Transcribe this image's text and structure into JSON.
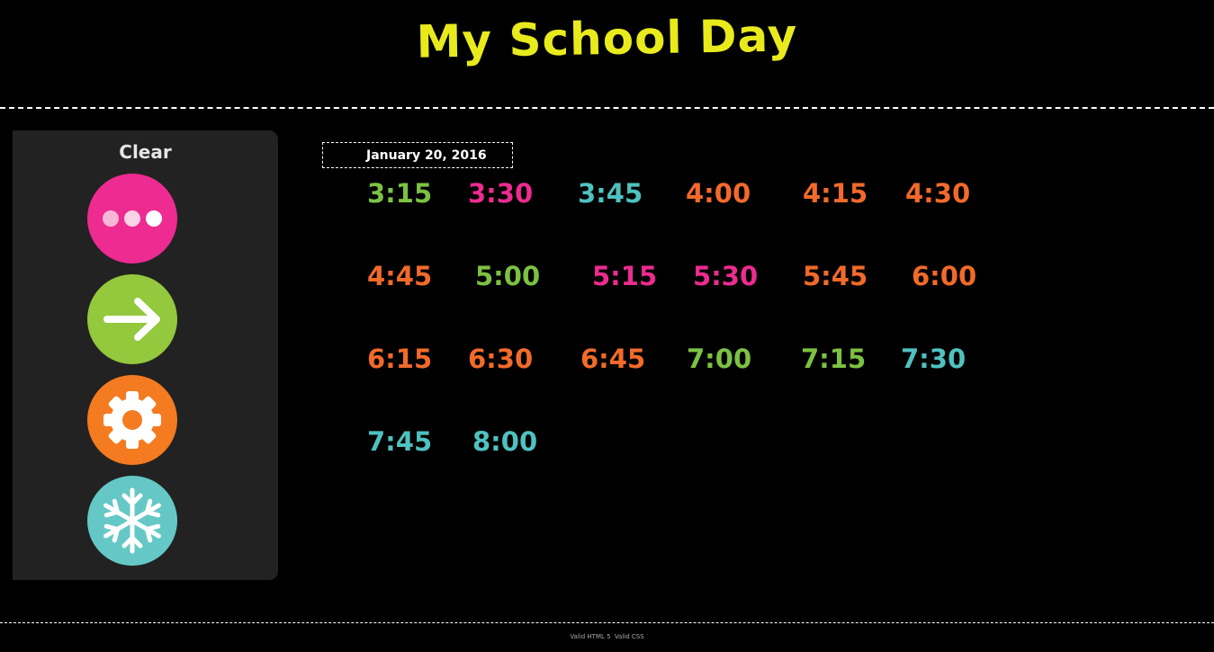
{
  "header": {
    "title": "My School Day"
  },
  "sidebar": {
    "clear_label": "Clear",
    "buttons": [
      {
        "name": "more-button",
        "icon": "ellipsis-icon",
        "color": "#ed2b91"
      },
      {
        "name": "next-button",
        "icon": "arrow-right-icon",
        "color": "#94c83d"
      },
      {
        "name": "settings-button",
        "icon": "gear-icon",
        "color": "#f47b20"
      },
      {
        "name": "snow-button",
        "icon": "snowflake-icon",
        "color": "#65c8c6"
      }
    ]
  },
  "date": {
    "value": "January 20, 2016"
  },
  "times": [
    {
      "label": "3:15",
      "color": "#7cc242"
    },
    {
      "label": "3:30",
      "color": "#ed2b91"
    },
    {
      "label": "3:45",
      "color": "#4fc1c0"
    },
    {
      "label": "4:00",
      "color": "#f26a2a"
    },
    {
      "label": "4:15",
      "color": "#f26a2a"
    },
    {
      "label": "4:30",
      "color": "#f26a2a"
    },
    {
      "label": "4:45",
      "color": "#f26a2a"
    },
    {
      "label": "5:00",
      "color": "#7cc242"
    },
    {
      "label": "5:15",
      "color": "#ed2b91"
    },
    {
      "label": "5:30",
      "color": "#ed2b91"
    },
    {
      "label": "5:45",
      "color": "#f26a2a"
    },
    {
      "label": "6:00",
      "color": "#f26a2a"
    },
    {
      "label": "6:15",
      "color": "#f26a2a"
    },
    {
      "label": "6:30",
      "color": "#f26a2a"
    },
    {
      "label": "6:45",
      "color": "#f26a2a"
    },
    {
      "label": "7:00",
      "color": "#7cc242"
    },
    {
      "label": "7:15",
      "color": "#7cc242"
    },
    {
      "label": "7:30",
      "color": "#4fc1c0"
    },
    {
      "label": "7:45",
      "color": "#4fc1c0"
    },
    {
      "label": "8:00",
      "color": "#4fc1c0"
    }
  ],
  "footer": {
    "html5_link": "Valid HTML 5",
    "css_link": "Valid CSS"
  }
}
